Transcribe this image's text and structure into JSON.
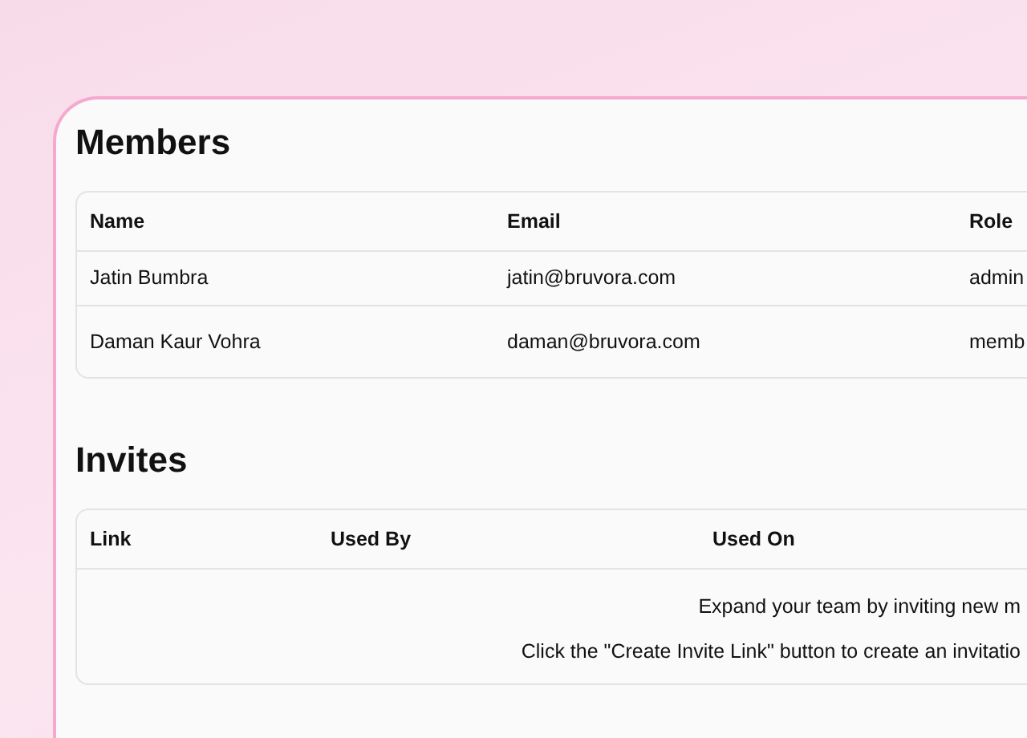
{
  "members": {
    "title": "Members",
    "columns": [
      "Name",
      "Email",
      "Role"
    ],
    "rows": [
      [
        "Jatin Bumbra",
        "jatin@bruvora.com",
        "admin"
      ],
      [
        "Daman Kaur Vohra",
        "daman@bruvora.com",
        "memb"
      ]
    ]
  },
  "invites": {
    "title": "Invites",
    "columns": [
      "Link",
      "Used By",
      "Used On"
    ],
    "empty_state": [
      "Expand your team by inviting new m",
      "Click the \"Create Invite Link\" button to create an invitatio"
    ]
  }
}
